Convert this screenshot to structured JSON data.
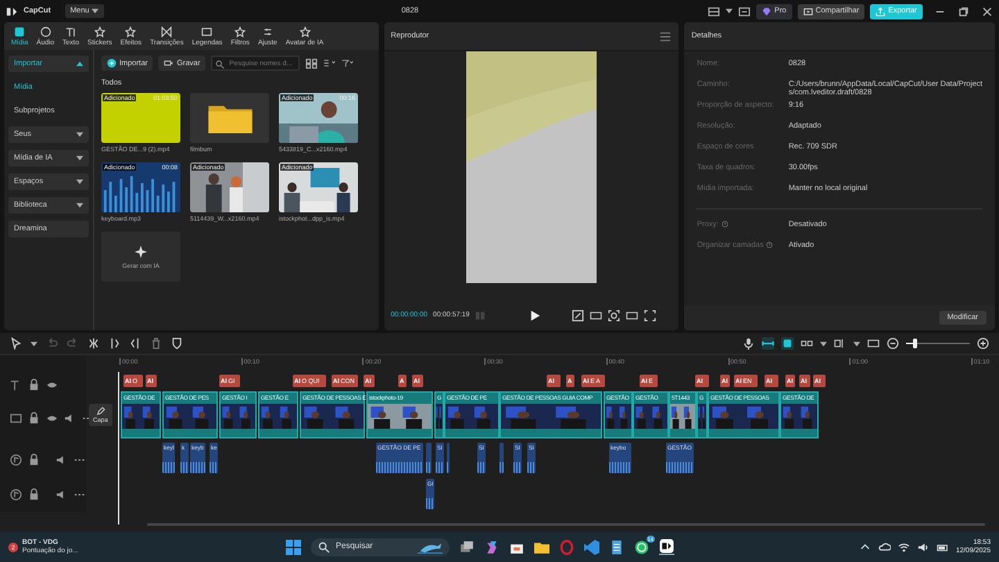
{
  "titlebar": {
    "app": "CapCut",
    "menu": "Menu",
    "project": "0828",
    "pro": "Pro",
    "share": "Compartilhar",
    "export": "Exportar"
  },
  "media_tabs": [
    {
      "label": "Mídia",
      "selected": true
    },
    {
      "label": "Áudio",
      "selected": false
    },
    {
      "label": "Texto",
      "selected": false
    },
    {
      "label": "Stickers",
      "selected": false
    },
    {
      "label": "Efeitos",
      "selected": false
    },
    {
      "label": "Transições",
      "selected": false
    },
    {
      "label": "Legendas",
      "selected": false
    },
    {
      "label": "Filtros",
      "selected": false
    },
    {
      "label": "Ajuste",
      "selected": false
    },
    {
      "label": "Avatar de IA",
      "selected": false
    }
  ],
  "sidebar": [
    {
      "kind": "group",
      "label": "Importar",
      "selected": true,
      "expanded": true
    },
    {
      "kind": "sub",
      "label": "Mídia",
      "selected": true
    },
    {
      "kind": "sub",
      "label": "Subprojetos",
      "selected": false
    },
    {
      "kind": "group",
      "label": "Seus",
      "selected": false,
      "expanded": false
    },
    {
      "kind": "group",
      "label": "Mídia de IA",
      "selected": false,
      "expanded": false
    },
    {
      "kind": "group",
      "label": "Espaços",
      "selected": false,
      "expanded": false
    },
    {
      "kind": "group",
      "label": "Biblioteca",
      "selected": false,
      "expanded": false
    },
    {
      "kind": "plain",
      "label": "Dreamina",
      "selected": false
    }
  ],
  "media_toolbar": {
    "import": "Importar",
    "record": "Gravar",
    "search_placeholder": "Pesquise nomes d..."
  },
  "media": {
    "heading": "Todos",
    "items": [
      {
        "kind": "video",
        "name": "GESTÃO DE...9 (2).mp4",
        "badge": "Adicionado",
        "duration": "01:03:50"
      },
      {
        "kind": "folder",
        "name": "filmbum"
      },
      {
        "kind": "video",
        "name": "5433819_C...x2160.mp4",
        "badge": "Adicionado",
        "duration": "00:16"
      },
      {
        "kind": "audio",
        "name": "keyboard.mp3",
        "badge": "Adicionado",
        "duration": "00:08"
      },
      {
        "kind": "video",
        "name": "5114439_W...x2160.mp4",
        "badge": "Adicionado"
      },
      {
        "kind": "video",
        "name": "istockphot...dpp_is.mp4",
        "badge": "Adicionado"
      },
      {
        "kind": "generate",
        "name": "Gerar com IA"
      }
    ]
  },
  "player": {
    "title": "Reprodutor",
    "current": "00:00:00:00",
    "total": "00:00:57:19"
  },
  "details": {
    "title": "Detalhes",
    "rows": [
      {
        "label": "Nome:",
        "value": "0828"
      },
      {
        "label": "Caminho:",
        "value": "C:/Users/brunn/AppData/Local/CapCut/User Data/Projects/com.lveditor.draft/0828"
      },
      {
        "label": "Proporção de aspecto:",
        "value": "9:16"
      },
      {
        "label": "Resolução:",
        "value": "Adaptado"
      },
      {
        "label": "Espaço de cores",
        "value": "Rec. 709 SDR"
      },
      {
        "label": "Taxa de quadros:",
        "value": "30.00fps"
      },
      {
        "label": "Mídia importada:",
        "value": "Manter no local original"
      }
    ],
    "settings": [
      {
        "label": "Proxy:",
        "value": "Desativado"
      },
      {
        "label": "Organizar camadas",
        "value": "Ativado"
      }
    ],
    "button": "Modificar"
  },
  "timeline": {
    "zoom_slider": {
      "level": 0.13
    },
    "cover": "Capa",
    "ruler": [
      "00:00",
      "00:10",
      "00:20",
      "00:30",
      "00:40",
      "00:50",
      "01:00",
      "01:10"
    ],
    "text_clips": [
      {
        "badge": "AI",
        "label": "O"
      },
      {
        "badge": "AI"
      },
      {
        "badge": "AI",
        "label": "GI"
      },
      {
        "badge": "AI",
        "label": "O QUI"
      },
      {
        "badge": "AI",
        "label": "CON"
      },
      {
        "badge": "AI"
      },
      {
        "badge": "A"
      },
      {
        "badge": "AI"
      },
      {
        "badge": "AI"
      },
      {
        "badge": "A"
      },
      {
        "badge": "AI",
        "label": "E A"
      },
      {
        "badge": "AI",
        "label": "E"
      },
      {
        "badge": "AI"
      },
      {
        "badge": "AI"
      },
      {
        "badge": "AI",
        "label": "EN"
      },
      {
        "badge": "AI"
      },
      {
        "badge": "AI"
      },
      {
        "badge": "AI"
      },
      {
        "badge": "AI"
      }
    ],
    "video_clips": [
      "GESTÃO DE",
      "GESTÃO DE PES",
      "GESTÃO I",
      "GESTÃO E",
      "GESTÃO DE PESSOAS E",
      "istockphoto-19",
      "G",
      "GESTÃO DE PE",
      "GESTÃO DE PESSOAS GUIA COMP",
      "GESTÃO",
      "GESTÃO",
      "5T1443",
      "G",
      "GESTÃO DE PESSOAS",
      "GESTÃO DE"
    ],
    "audio_clips": [
      {
        "kind": "audio",
        "label": "keyl"
      },
      {
        "kind": "audio",
        "label": "k"
      },
      {
        "kind": "audio",
        "label": "keyb"
      },
      {
        "kind": "audio",
        "label": "ke"
      },
      {
        "kind": "audio",
        "label": "GESTÃO DE PE"
      },
      {
        "kind": "audio"
      },
      {
        "kind": "audio",
        "label": "SI"
      },
      {
        "kind": "audio"
      },
      {
        "kind": "audio",
        "label": "SI"
      },
      {
        "kind": "audio"
      },
      {
        "kind": "audio",
        "label": "SI"
      },
      {
        "kind": "audio",
        "label": "SI"
      },
      {
        "kind": "audio",
        "label": "keybo"
      },
      {
        "kind": "audio",
        "label": "GESTÃO"
      }
    ],
    "audio2_clips": [
      {
        "kind": "audio",
        "label": "GI"
      }
    ]
  },
  "taskbar": {
    "notification_count": "2",
    "notification_title": "BOT - VDG",
    "notification_text": "Pontuação do jo...",
    "search": "Pesquisar",
    "whatsapp_badge": "14",
    "time": "18:53",
    "date": "12/09/2025"
  }
}
